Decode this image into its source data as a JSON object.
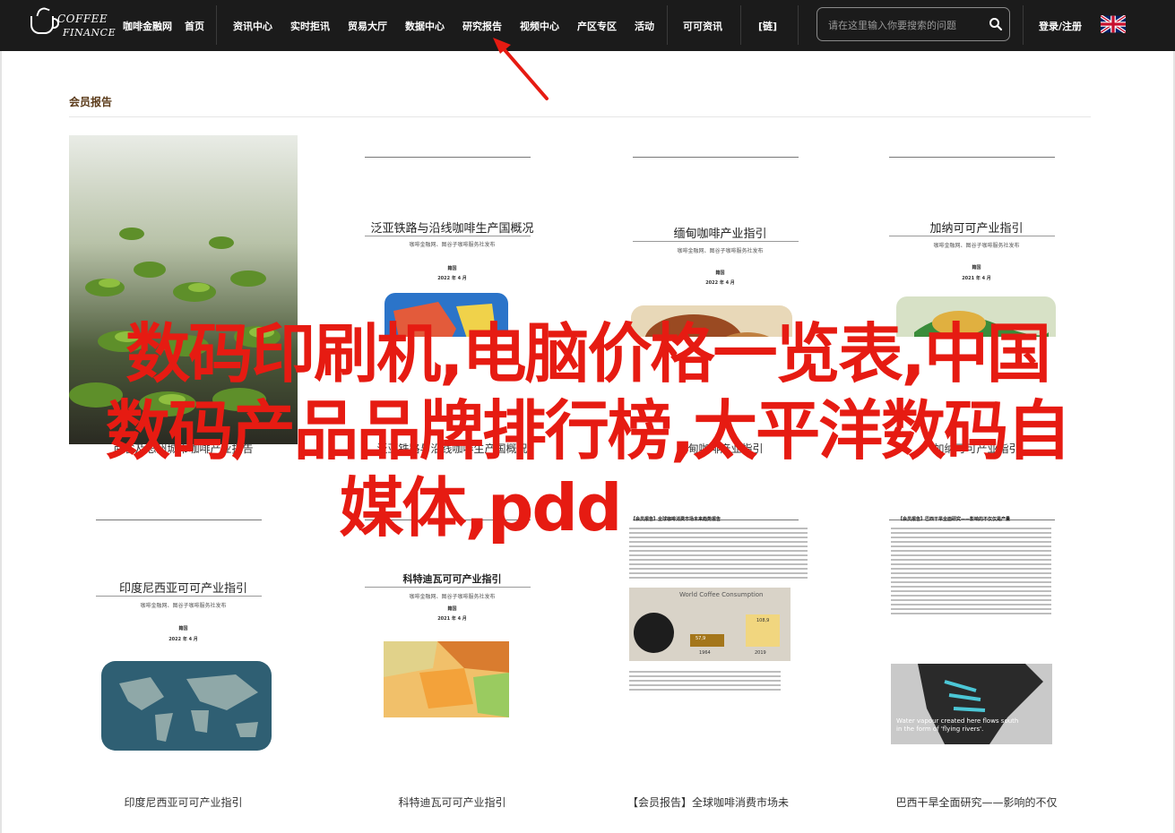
{
  "header": {
    "logo_line1": "COFFEE",
    "logo_line2": "FINANCE",
    "nav_left": [
      "咖啡金融网",
      "首页"
    ],
    "nav_main": [
      "资讯中心",
      "实时拒讯",
      "贸易大厅",
      "数据中心",
      "研究报告",
      "视频中心",
      "产区专区",
      "活动"
    ],
    "nav_right1": "可可资讯",
    "nav_right2": "[链]",
    "search_placeholder": "请在这里输入你要搜索的问题",
    "login": "登录/注册"
  },
  "section_title": "会员报告",
  "cards_row1": [
    {
      "type": "photo",
      "caption": "南省及思州城市咖啡产业报告"
    },
    {
      "type": "doc",
      "title": "泛亚铁路与沿线咖啡生产国概况",
      "sub": "咖啡金融网、图谷子咖啡服务社发布",
      "org": "籍国",
      "date": "2022 年 4 月",
      "caption": "泛亚铁路与沿线咖啡生产国概况"
    },
    {
      "type": "doc",
      "title": "缅甸咖啡产业指引",
      "sub": "咖啡金融网、图谷子咖啡服务社发布",
      "org": "籍国",
      "date": "2022 年 4 月",
      "caption": "缅甸咖啡产业指引"
    },
    {
      "type": "doc",
      "title": "加纳可可产业指引",
      "sub": "咖啡金融网、图谷子咖啡服务社发布",
      "org": "籍国",
      "date": "2021 年 4 月",
      "caption": "加纳可可产业指引"
    }
  ],
  "cards_row2": [
    {
      "type": "doc",
      "title": "印度尼西亚可可产业指引",
      "sub": "咖啡金融网、图谷子咖啡服务社发布",
      "org": "籍国",
      "date": "2022 年 4 月",
      "caption": "印度尼西亚可可产业指引"
    },
    {
      "type": "doc",
      "title": "科特迪瓦可可产业指引",
      "sub": "咖啡金融网、图谷子咖啡服务社发布",
      "org": "籍国",
      "date": "2021 年 4 月",
      "caption": "科特迪瓦可可产业指引"
    },
    {
      "type": "report",
      "title": "【会员报告】全球咖啡消费市场未来趋势报告",
      "chart_title": "World Coffee Consumption",
      "bar1": "57,9",
      "bar2": "108,9",
      "year1": "1964",
      "year2": "2019",
      "caption": "【会员报告】全球咖啡消费市场未"
    },
    {
      "type": "report2",
      "title": "【会员报告】巴西干旱全面研究——影响的不仅仅是产量",
      "map_text": "Water vapour created here flows south in the form of 'flying rivers'.",
      "caption": "巴西干旱全面研究——影响的不仅"
    }
  ],
  "overlay_lines": [
    "数码印刷机,电脑价格一览表,中国",
    "数码产品品牌排行榜,太平洋数码自",
    "媒体,pdd"
  ],
  "colors": {
    "accent_red": "#e61b12",
    "nav_bg": "#1b1b1b",
    "section_title": "#5b3b1a"
  }
}
